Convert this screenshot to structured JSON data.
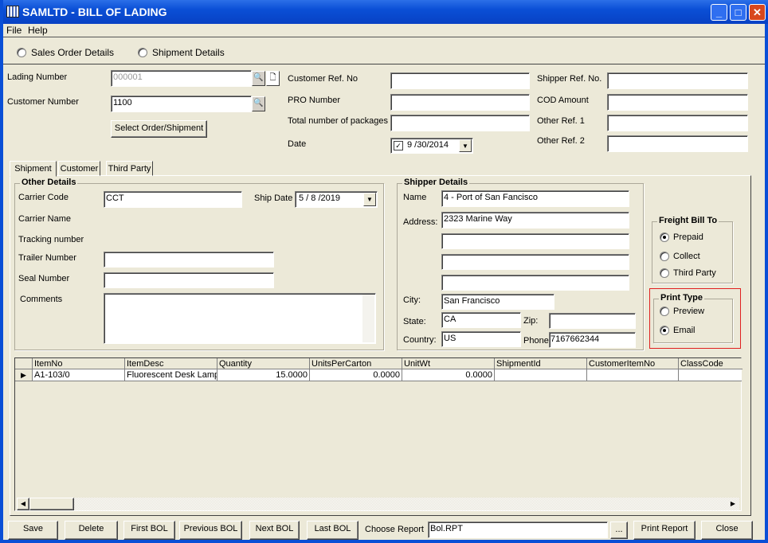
{
  "window": {
    "title": "SAMLTD - BILL OF LADING",
    "controls": [
      "minimize",
      "maximize",
      "close"
    ]
  },
  "menu": [
    "File",
    "Help"
  ],
  "mode_radios": [
    {
      "label": "Sales Order Details",
      "selected": false
    },
    {
      "label": "Shipment Details",
      "selected": false
    }
  ],
  "header": {
    "lading_number": {
      "label": "Lading Number",
      "value": "000001"
    },
    "customer_number": {
      "label": "Customer Number",
      "value": "1100"
    },
    "select_button": "Select Order/Shipment",
    "customer_ref": {
      "label": "Customer Ref. No",
      "value": ""
    },
    "pro_number": {
      "label": "PRO Number",
      "value": ""
    },
    "total_packages": {
      "label": "Total number of packages",
      "value": ""
    },
    "date": {
      "label": "Date",
      "value": "9 /30/2014",
      "checked": true
    },
    "shipper_ref": {
      "label": "Shipper Ref. No.",
      "value": ""
    },
    "cod_amount": {
      "label": "COD Amount",
      "value": ""
    },
    "other_ref1": {
      "label": "Other Ref. 1",
      "value": ""
    },
    "other_ref2": {
      "label": "Other Ref. 2",
      "value": ""
    }
  },
  "tabs": [
    {
      "label": "Shipment",
      "active": true
    },
    {
      "label": "Customer",
      "active": false
    },
    {
      "label": "Third Party",
      "active": false
    }
  ],
  "other_details": {
    "title": "Other Details",
    "carrier_code": {
      "label": "Carrier Code",
      "value": "CCT"
    },
    "ship_date": {
      "label": "Ship Date",
      "value": "5 / 8 /2019"
    },
    "carrier_name": {
      "label": "Carrier Name"
    },
    "tracking_number": {
      "label": "Tracking number"
    },
    "trailer_number": {
      "label": "Trailer Number",
      "value": ""
    },
    "seal_number": {
      "label": "Seal Number",
      "value": ""
    },
    "comments": {
      "label": "Comments",
      "value": ""
    }
  },
  "shipper_details": {
    "title": "Shipper  Details",
    "name": {
      "label": "Name",
      "value": "4 - Port of San Fancisco"
    },
    "address": {
      "label": "Address:",
      "lines": [
        "2323 Marine Way",
        "",
        "",
        ""
      ]
    },
    "city": {
      "label": "City:",
      "value": "San Francisco"
    },
    "state": {
      "label": "State:",
      "value": "CA"
    },
    "zip": {
      "label": "Zip:",
      "value": ""
    },
    "country": {
      "label": "Country:",
      "value": "US"
    },
    "phone": {
      "label": "Phone",
      "value": "7167662344"
    }
  },
  "freight_bill_to": {
    "title": "Freight Bill To",
    "options": [
      {
        "label": "Prepaid",
        "selected": true
      },
      {
        "label": "Collect",
        "selected": false
      },
      {
        "label": "Third Party",
        "selected": false
      }
    ]
  },
  "print_type": {
    "title": "Print Type",
    "options": [
      {
        "label": "Preview",
        "selected": false
      },
      {
        "label": "Email",
        "selected": true
      }
    ],
    "highlight_color": "#e02020"
  },
  "grid": {
    "columns": [
      "ItemNo",
      "ItemDesc",
      "Quantity",
      "UnitsPerCarton",
      "UnitWt",
      "ShipmentId",
      "CustomerItemNo",
      "ClassCode"
    ],
    "rows": [
      [
        "A1-103/0",
        "Fluorescent Desk Lamp",
        "15.0000",
        "0.0000",
        "0.0000",
        "",
        "",
        ""
      ]
    ]
  },
  "footer": {
    "save": "Save",
    "delete": "Delete",
    "first": "First BOL",
    "previous": "Previous BOL",
    "next": "Next BOL",
    "last": "Last BOL",
    "choose_report_label": "Choose Report",
    "choose_report_value": "Bol.RPT",
    "browse": "...",
    "print_report": "Print Report",
    "close": "Close"
  }
}
